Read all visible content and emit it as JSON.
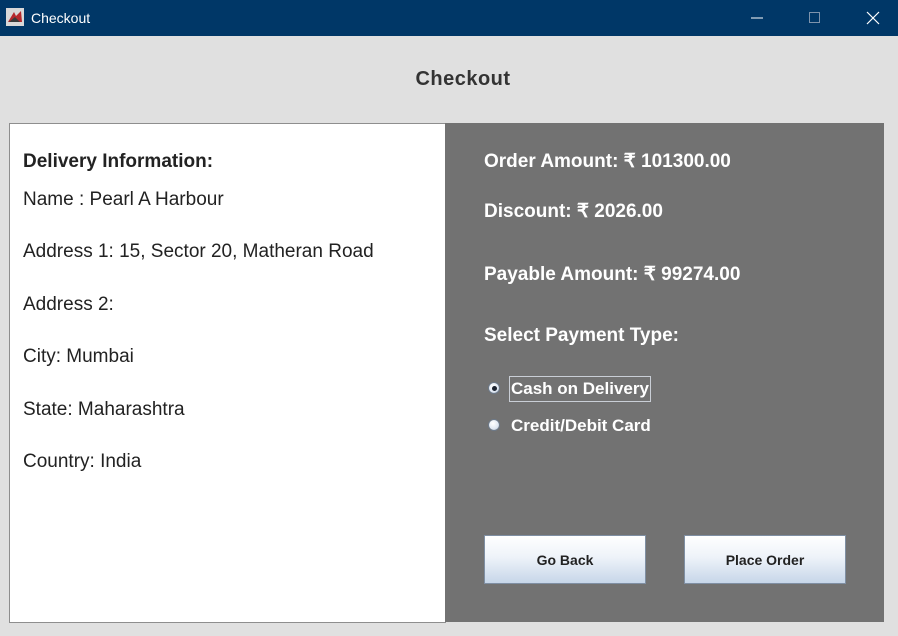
{
  "window": {
    "title": "Checkout"
  },
  "page": {
    "heading": "Checkout"
  },
  "delivery": {
    "heading": "Delivery Information:",
    "name": "Name : Pearl A Harbour",
    "address1": "Address 1: 15, Sector 20, Matheran Road",
    "address2": "Address 2:",
    "city": "City: Mumbai",
    "state": "State: Maharashtra",
    "country": "Country: India"
  },
  "summary": {
    "order_amount": "Order Amount:  ₹ 101300.00",
    "discount": "Discount: ₹ 2026.00",
    "payable_amount": "Payable Amount: ₹ 99274.00",
    "payment_heading": "Select Payment Type:",
    "payment_options": [
      {
        "label": "Cash on Delivery",
        "selected": true
      },
      {
        "label": "Credit/Debit Card",
        "selected": false
      }
    ]
  },
  "buttons": {
    "go_back": "Go Back",
    "place_order": "Place Order"
  },
  "colors": {
    "titlebar": "#003767",
    "summary_panel": "#727272",
    "background": "#e0e0e0"
  }
}
